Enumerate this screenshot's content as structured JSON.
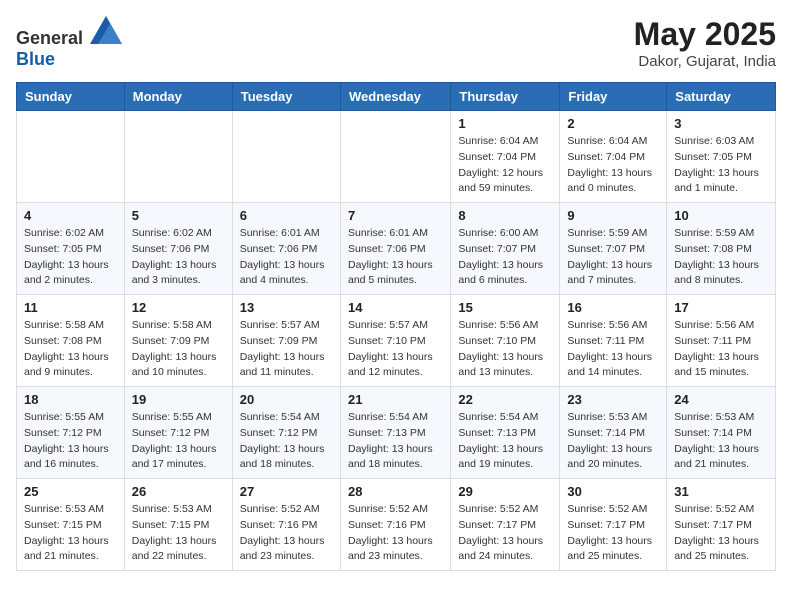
{
  "header": {
    "logo_general": "General",
    "logo_blue": "Blue",
    "month_year": "May 2025",
    "location": "Dakor, Gujarat, India"
  },
  "weekdays": [
    "Sunday",
    "Monday",
    "Tuesday",
    "Wednesday",
    "Thursday",
    "Friday",
    "Saturday"
  ],
  "weeks": [
    [
      {
        "day": "",
        "info": ""
      },
      {
        "day": "",
        "info": ""
      },
      {
        "day": "",
        "info": ""
      },
      {
        "day": "",
        "info": ""
      },
      {
        "day": "1",
        "info": "Sunrise: 6:04 AM\nSunset: 7:04 PM\nDaylight: 12 hours\nand 59 minutes."
      },
      {
        "day": "2",
        "info": "Sunrise: 6:04 AM\nSunset: 7:04 PM\nDaylight: 13 hours\nand 0 minutes."
      },
      {
        "day": "3",
        "info": "Sunrise: 6:03 AM\nSunset: 7:05 PM\nDaylight: 13 hours\nand 1 minute."
      }
    ],
    [
      {
        "day": "4",
        "info": "Sunrise: 6:02 AM\nSunset: 7:05 PM\nDaylight: 13 hours\nand 2 minutes."
      },
      {
        "day": "5",
        "info": "Sunrise: 6:02 AM\nSunset: 7:06 PM\nDaylight: 13 hours\nand 3 minutes."
      },
      {
        "day": "6",
        "info": "Sunrise: 6:01 AM\nSunset: 7:06 PM\nDaylight: 13 hours\nand 4 minutes."
      },
      {
        "day": "7",
        "info": "Sunrise: 6:01 AM\nSunset: 7:06 PM\nDaylight: 13 hours\nand 5 minutes."
      },
      {
        "day": "8",
        "info": "Sunrise: 6:00 AM\nSunset: 7:07 PM\nDaylight: 13 hours\nand 6 minutes."
      },
      {
        "day": "9",
        "info": "Sunrise: 5:59 AM\nSunset: 7:07 PM\nDaylight: 13 hours\nand 7 minutes."
      },
      {
        "day": "10",
        "info": "Sunrise: 5:59 AM\nSunset: 7:08 PM\nDaylight: 13 hours\nand 8 minutes."
      }
    ],
    [
      {
        "day": "11",
        "info": "Sunrise: 5:58 AM\nSunset: 7:08 PM\nDaylight: 13 hours\nand 9 minutes."
      },
      {
        "day": "12",
        "info": "Sunrise: 5:58 AM\nSunset: 7:09 PM\nDaylight: 13 hours\nand 10 minutes."
      },
      {
        "day": "13",
        "info": "Sunrise: 5:57 AM\nSunset: 7:09 PM\nDaylight: 13 hours\nand 11 minutes."
      },
      {
        "day": "14",
        "info": "Sunrise: 5:57 AM\nSunset: 7:10 PM\nDaylight: 13 hours\nand 12 minutes."
      },
      {
        "day": "15",
        "info": "Sunrise: 5:56 AM\nSunset: 7:10 PM\nDaylight: 13 hours\nand 13 minutes."
      },
      {
        "day": "16",
        "info": "Sunrise: 5:56 AM\nSunset: 7:11 PM\nDaylight: 13 hours\nand 14 minutes."
      },
      {
        "day": "17",
        "info": "Sunrise: 5:56 AM\nSunset: 7:11 PM\nDaylight: 13 hours\nand 15 minutes."
      }
    ],
    [
      {
        "day": "18",
        "info": "Sunrise: 5:55 AM\nSunset: 7:12 PM\nDaylight: 13 hours\nand 16 minutes."
      },
      {
        "day": "19",
        "info": "Sunrise: 5:55 AM\nSunset: 7:12 PM\nDaylight: 13 hours\nand 17 minutes."
      },
      {
        "day": "20",
        "info": "Sunrise: 5:54 AM\nSunset: 7:12 PM\nDaylight: 13 hours\nand 18 minutes."
      },
      {
        "day": "21",
        "info": "Sunrise: 5:54 AM\nSunset: 7:13 PM\nDaylight: 13 hours\nand 18 minutes."
      },
      {
        "day": "22",
        "info": "Sunrise: 5:54 AM\nSunset: 7:13 PM\nDaylight: 13 hours\nand 19 minutes."
      },
      {
        "day": "23",
        "info": "Sunrise: 5:53 AM\nSunset: 7:14 PM\nDaylight: 13 hours\nand 20 minutes."
      },
      {
        "day": "24",
        "info": "Sunrise: 5:53 AM\nSunset: 7:14 PM\nDaylight: 13 hours\nand 21 minutes."
      }
    ],
    [
      {
        "day": "25",
        "info": "Sunrise: 5:53 AM\nSunset: 7:15 PM\nDaylight: 13 hours\nand 21 minutes."
      },
      {
        "day": "26",
        "info": "Sunrise: 5:53 AM\nSunset: 7:15 PM\nDaylight: 13 hours\nand 22 minutes."
      },
      {
        "day": "27",
        "info": "Sunrise: 5:52 AM\nSunset: 7:16 PM\nDaylight: 13 hours\nand 23 minutes."
      },
      {
        "day": "28",
        "info": "Sunrise: 5:52 AM\nSunset: 7:16 PM\nDaylight: 13 hours\nand 23 minutes."
      },
      {
        "day": "29",
        "info": "Sunrise: 5:52 AM\nSunset: 7:17 PM\nDaylight: 13 hours\nand 24 minutes."
      },
      {
        "day": "30",
        "info": "Sunrise: 5:52 AM\nSunset: 7:17 PM\nDaylight: 13 hours\nand 25 minutes."
      },
      {
        "day": "31",
        "info": "Sunrise: 5:52 AM\nSunset: 7:17 PM\nDaylight: 13 hours\nand 25 minutes."
      }
    ]
  ]
}
